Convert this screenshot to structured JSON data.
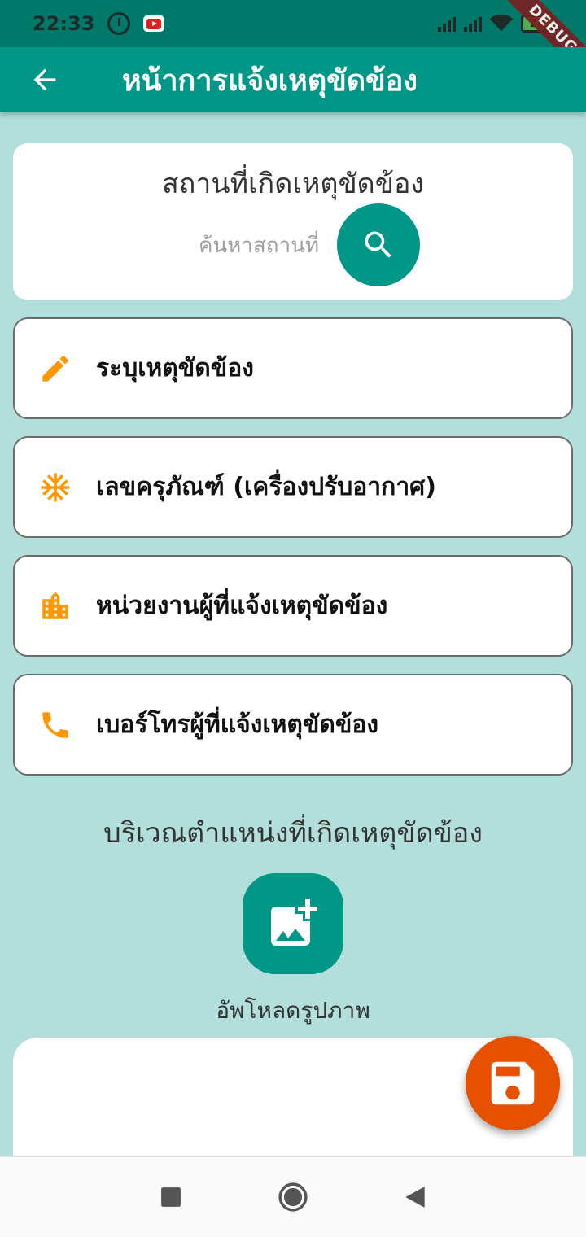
{
  "status_bar": {
    "time": "22:33",
    "battery": "28",
    "debug_label": "DEBUG"
  },
  "app_bar": {
    "title": "หน้าการแจ้งเหตุขัดข้อง"
  },
  "location": {
    "title": "สถานที่เกิดเหตุขัดข้อง",
    "search_placeholder": "ค้นหาสถานที่"
  },
  "fields": [
    {
      "label": "ระบุเหตุขัดข้อง",
      "icon": "pencil-icon"
    },
    {
      "label": "เลขครุภัณฑ์ (เครื่องปรับอากาศ)",
      "icon": "snowflake-icon"
    },
    {
      "label": "หน่วยงานผู้ที่แจ้งเหตุขัดข้อง",
      "icon": "building-icon"
    },
    {
      "label": "เบอร์โทรผู้ที่แจ้งเหตุขัดข้อง",
      "icon": "phone-icon"
    }
  ],
  "area": {
    "title": "บริเวณตำแหน่งที่เกิดเหตุขัดข้อง",
    "upload_label": "อัพโหลดรูปภาพ"
  },
  "colors": {
    "primary": "#009688",
    "accent": "#ff9800",
    "save": "#e65100",
    "background": "#b2dfdb"
  }
}
